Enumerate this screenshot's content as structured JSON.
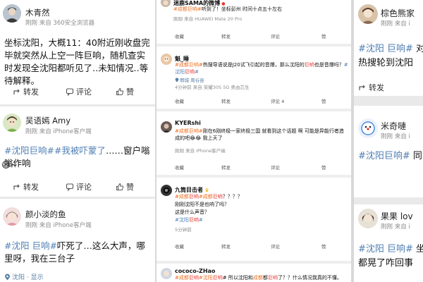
{
  "left": {
    "posts": [
      {
        "name": "木青然",
        "time": "刚刚",
        "source": "来自 360安全浏览器",
        "text": "坐标沈阳，大概11：40附近刚收盘完毕就突然从上空一阵巨响，随机查实时发现全沈阳都听见了‥未知情况‥等待解释。",
        "actions": {
          "repost": "转发",
          "comment": "评论",
          "like": "赞"
        }
      },
      {
        "name": "吴语嫣 Amy",
        "time": "刚刚",
        "source": "来自 iPhone客户端",
        "tags": [
          "#沈阳巨响#",
          "#我被吓蒙了"
        ],
        "text": "……窗户嗡嗡作响",
        "tail": "~",
        "actions": {
          "repost": "转发",
          "comment": "评论",
          "like": "赞"
        }
      },
      {
        "name": "颜小淡的鱼",
        "time": "刚刚",
        "source": "来自 iPhone客户端",
        "tag": "#沈阳 巨响#",
        "text": "吓死了…这么大声，哪里呀，我在三台子",
        "location": "沈阳 · 显示"
      }
    ]
  },
  "middle": {
    "posts": [
      {
        "name": "迷鹿SAMA的微博",
        "text_parts": [
          "#成都巨响#",
          "听到了！坐标彭州 时间十点五十左右"
        ],
        "meta": "刚刚 来自 HUAWEI Mate 20 Pro",
        "actions": {
          "fav": "收藏",
          "repost": "转发",
          "comment": "评论",
          "like": "赞"
        }
      },
      {
        "name": "魁_睡",
        "text_parts": [
          "#成都巨响#",
          "热搜导语说是J20试飞引起的音爆，那么沈阳的",
          "巨响",
          "也是音爆吗？",
          "#沈阳",
          "巨响",
          "#"
        ],
        "location": "郫城·周谷县",
        "meta": "4分钟前 来自 荣耀30S 5G 奥由芯生",
        "actions": {
          "fav": "收藏",
          "repost": "转发",
          "comment": "评论 4",
          "like": "赞"
        }
      },
      {
        "name": "KYERshi",
        "text_parts": [
          "#成都巨响#",
          "刚在6刚终极一家终极三国 就看到这个话题 啊 可能是异能行者造成的吧",
          "😂😂",
          " 我上天了"
        ],
        "meta": "刚刚 来自 iPhone客户端",
        "actions": {
          "fav": "收藏",
          "repost": "转发",
          "comment": "评论",
          "like": "赞"
        }
      },
      {
        "name": "九筒目击者",
        "text_parts": [
          "#成都",
          "巨响",
          "#成都",
          "巨响",
          "？？？？",
          "刚刚沈阳不是也响了吗？",
          "这是什么声音？",
          "#沈阳",
          "巨响",
          "#"
        ],
        "meta": "5分钟前",
        "actions": {
          "fav": "收藏",
          "repost": "转发",
          "comment": "评论",
          "like": "赞"
        }
      },
      {
        "name": "cococo-ZHao",
        "text_parts": [
          "#成都",
          "巨响",
          "#沈阳",
          "巨响",
          "# 所以沈阳和",
          "成都",
          "都",
          "巨响",
          "了？？什么情况我真的不懂。"
        ]
      }
    ]
  },
  "right": {
    "posts": [
      {
        "name": "棕色熊家",
        "time": "刚刚",
        "source": "来自 i",
        "tag": "#沈阳 巨响#",
        "text_tail": " 对",
        "text2": "热搜轮到沈阳",
        "actions": {
          "repost": "转发"
        }
      },
      {
        "name": "米奇嗹",
        "time": "刚刚",
        "source": "来自 i",
        "tag": "#沈阳巨响#",
        "text_tail": " 同"
      },
      {
        "name": "果果 lov",
        "time": "刚刚",
        "source": "来自 i",
        "tag": "#沈阳 巨响#",
        "text_tail": " 坐",
        "text2": "都晃了咋回事"
      }
    ]
  }
}
